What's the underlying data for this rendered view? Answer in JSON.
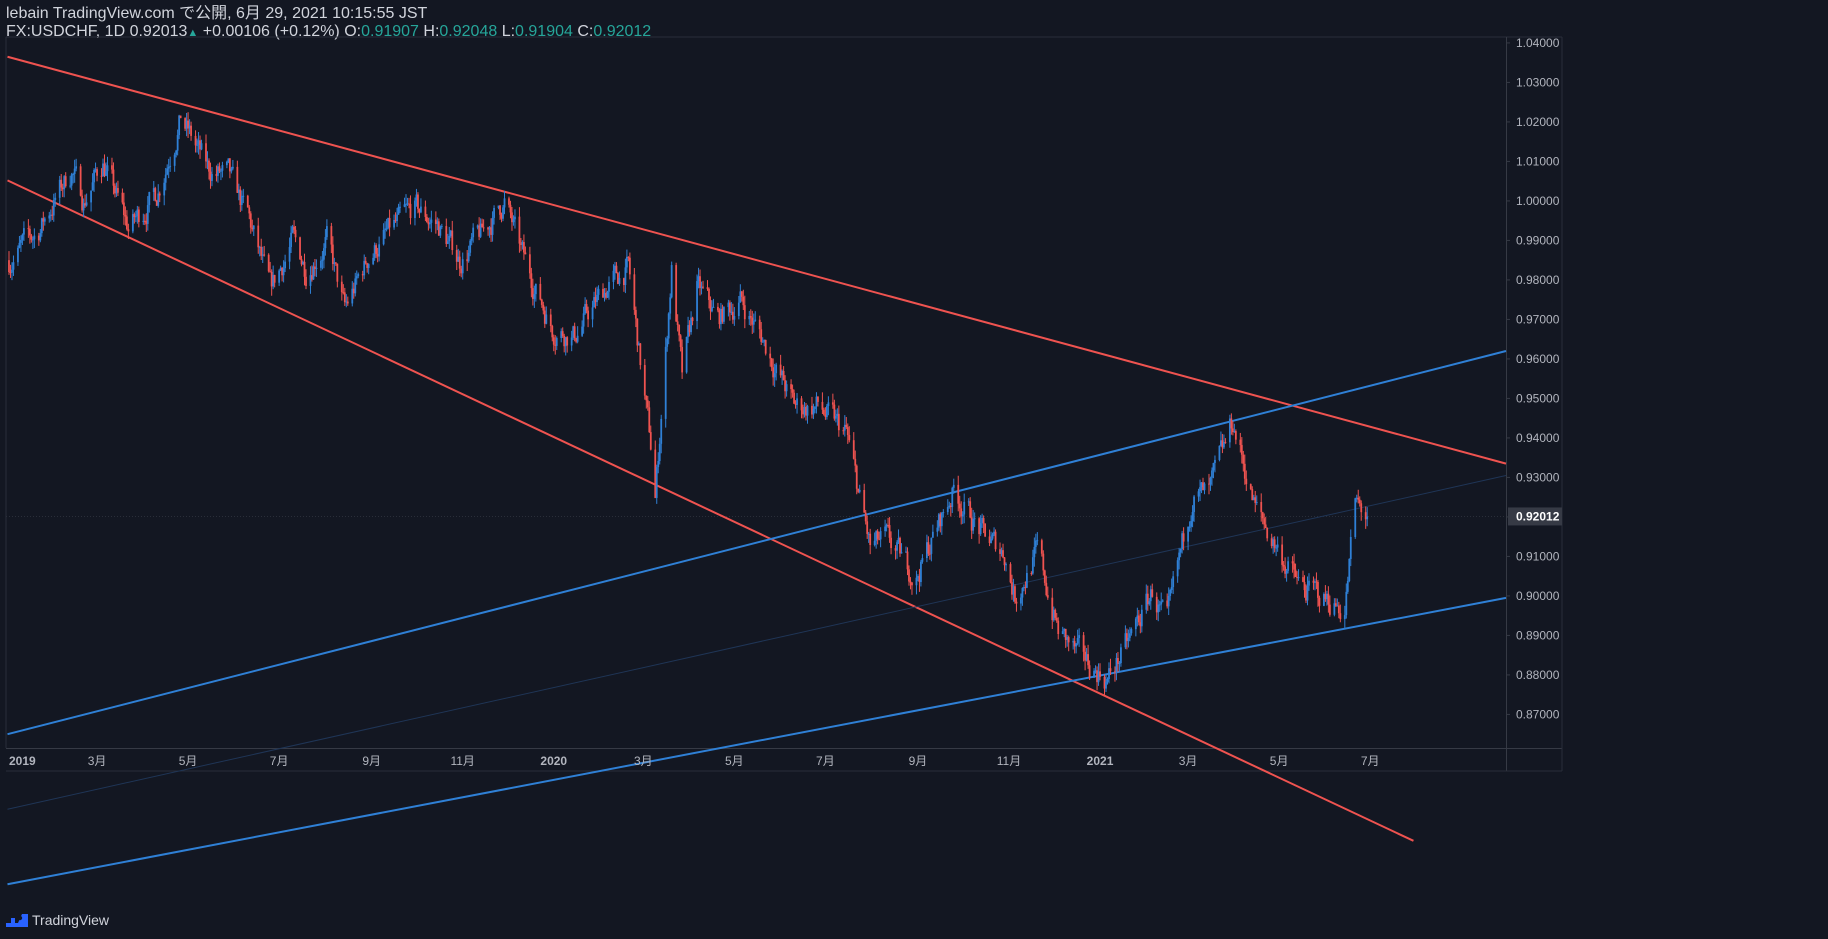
{
  "header": {
    "line1": "lebain TradingView.com で公開, 6月 29, 2021 10:15:55 JST",
    "symbol": "FX:USDCHF, 1D",
    "last": "0.92013",
    "change": "+0.00106 (+0.12%)",
    "o_label": "O:",
    "o_val": "0.91907",
    "h_label": "H:",
    "h_val": "0.92048",
    "l_label": "L:",
    "l_val": "0.91904",
    "c_label": "C:",
    "c_val": "0.92012"
  },
  "footer": {
    "brand": "TradingView"
  },
  "colors": {
    "background": "#131722",
    "up": "#2f80d6",
    "down": "#ef5350",
    "red_line": "#ef5350",
    "blue_line": "#2f80d6",
    "axis_text": "#b2b5be",
    "ohlc_value": "#26a69a",
    "price_label_bg": "#363a45"
  },
  "chart_data": {
    "type": "candlestick",
    "symbol": "FX:USDCHF",
    "interval": "1D",
    "ylim": [
      0.8615,
      1.0415
    ],
    "xlim": [
      "2018-12-30",
      "2021-09-30"
    ],
    "y_ticks": [
      "1.04000",
      "1.03000",
      "1.02000",
      "1.01000",
      "1.00000",
      "0.99000",
      "0.98000",
      "0.97000",
      "0.96000",
      "0.95000",
      "0.94000",
      "0.93000",
      "0.92000",
      "0.91000",
      "0.90000",
      "0.89000",
      "0.88000",
      "0.87000"
    ],
    "current_price_label": "0.92012",
    "current_price": 0.92012,
    "x_ticks": [
      {
        "label": "2019",
        "date": "2019-01-01",
        "bold": true
      },
      {
        "label": "3月",
        "date": "2019-03-01",
        "bold": false
      },
      {
        "label": "5月",
        "date": "2019-05-01",
        "bold": false
      },
      {
        "label": "7月",
        "date": "2019-07-01",
        "bold": false
      },
      {
        "label": "9月",
        "date": "2019-09-01",
        "bold": false
      },
      {
        "label": "11月",
        "date": "2019-11-01",
        "bold": false
      },
      {
        "label": "2020",
        "date": "2020-01-01",
        "bold": true
      },
      {
        "label": "3月",
        "date": "2020-03-01",
        "bold": false
      },
      {
        "label": "5月",
        "date": "2020-05-01",
        "bold": false
      },
      {
        "label": "7月",
        "date": "2020-07-01",
        "bold": false
      },
      {
        "label": "9月",
        "date": "2020-09-01",
        "bold": false
      },
      {
        "label": "11月",
        "date": "2020-11-01",
        "bold": false
      },
      {
        "label": "2021",
        "date": "2021-01-01",
        "bold": true
      },
      {
        "label": "3月",
        "date": "2021-03-01",
        "bold": false
      },
      {
        "label": "5月",
        "date": "2021-05-01",
        "bold": false
      },
      {
        "label": "7月",
        "date": "2021-07-01",
        "bold": false
      }
    ],
    "price_anchors": [
      [
        "2019-01-01",
        0.985
      ],
      [
        "2019-01-20",
        0.992
      ],
      [
        "2019-02-12",
        1.008
      ],
      [
        "2019-02-20",
        1.0
      ],
      [
        "2019-03-05",
        1.01
      ],
      [
        "2019-03-22",
        0.993
      ],
      [
        "2019-04-10",
        1.002
      ],
      [
        "2019-04-26",
        1.021
      ],
      [
        "2019-05-14",
        1.008
      ],
      [
        "2019-05-28",
        1.006
      ],
      [
        "2019-06-10",
        0.996
      ],
      [
        "2019-06-25",
        0.977
      ],
      [
        "2019-07-10",
        0.99
      ],
      [
        "2019-07-19",
        0.983
      ],
      [
        "2019-08-02",
        0.99
      ],
      [
        "2019-08-14",
        0.972
      ],
      [
        "2019-08-30",
        0.986
      ],
      [
        "2019-09-10",
        0.991
      ],
      [
        "2019-09-30",
        0.998
      ],
      [
        "2019-10-15",
        0.994
      ],
      [
        "2019-10-30",
        0.985
      ],
      [
        "2019-11-15",
        0.992
      ],
      [
        "2019-11-29",
        1.0
      ],
      [
        "2019-12-10",
        0.987
      ],
      [
        "2019-12-31",
        0.968
      ],
      [
        "2020-01-15",
        0.966
      ],
      [
        "2020-02-05",
        0.978
      ],
      [
        "2020-02-20",
        0.983
      ],
      [
        "2020-03-06",
        0.938
      ],
      [
        "2020-03-09",
        0.925
      ],
      [
        "2020-03-20",
        0.983
      ],
      [
        "2020-03-27",
        0.955
      ],
      [
        "2020-04-06",
        0.978
      ],
      [
        "2020-04-20",
        0.97
      ],
      [
        "2020-05-05",
        0.975
      ],
      [
        "2020-05-20",
        0.965
      ],
      [
        "2020-06-10",
        0.948
      ],
      [
        "2020-06-25",
        0.948
      ],
      [
        "2020-07-15",
        0.941
      ],
      [
        "2020-07-31",
        0.912
      ],
      [
        "2020-08-10",
        0.914
      ],
      [
        "2020-08-31",
        0.905
      ],
      [
        "2020-09-25",
        0.927
      ],
      [
        "2020-10-15",
        0.915
      ],
      [
        "2020-10-29",
        0.911
      ],
      [
        "2020-11-05",
        0.9
      ],
      [
        "2020-11-20",
        0.911
      ],
      [
        "2020-12-04",
        0.891
      ],
      [
        "2020-12-17",
        0.885
      ],
      [
        "2021-01-06",
        0.879
      ],
      [
        "2021-01-20",
        0.888
      ],
      [
        "2021-02-05",
        0.901
      ],
      [
        "2021-02-15",
        0.892
      ],
      [
        "2021-03-04",
        0.926
      ],
      [
        "2021-03-15",
        0.925
      ],
      [
        "2021-03-31",
        0.944
      ],
      [
        "2021-04-15",
        0.922
      ],
      [
        "2021-04-30",
        0.912
      ],
      [
        "2021-05-15",
        0.902
      ],
      [
        "2021-06-03",
        0.899
      ],
      [
        "2021-06-14",
        0.897
      ],
      [
        "2021-06-21",
        0.923
      ],
      [
        "2021-06-29",
        0.92
      ]
    ],
    "trendlines": [
      {
        "name": "channel-upper",
        "color": "red",
        "from": [
          "2018-12-31",
          1.0365
        ],
        "to": [
          "2021-09-30",
          0.9335
        ]
      },
      {
        "name": "channel-lower",
        "color": "red",
        "from": [
          "2018-12-31",
          1.0052
        ],
        "to": [
          "2021-07-30",
          0.838
        ]
      },
      {
        "name": "rising-upper",
        "color": "blue",
        "from": [
          "2018-12-31",
          0.865
        ],
        "to": [
          "2021-09-30",
          0.962
        ]
      },
      {
        "name": "rising-lower",
        "color": "blue",
        "from": [
          "2018-12-31",
          0.827
        ],
        "to": [
          "2021-09-30",
          0.8995
        ]
      },
      {
        "name": "rising-mid",
        "color": "faint",
        "from": [
          "2018-12-31",
          0.846
        ],
        "to": [
          "2021-09-30",
          0.9305
        ]
      }
    ]
  }
}
